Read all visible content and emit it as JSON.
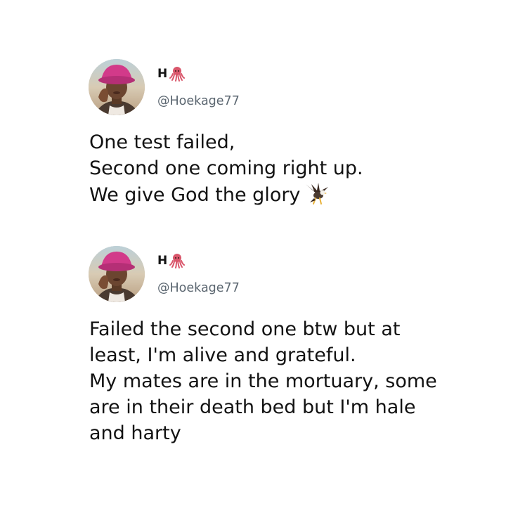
{
  "tweets": [
    {
      "display_name": "H",
      "name_emoji": "octopus-icon",
      "handle": "@Hoekage77",
      "lines": [
        "One test failed,",
        "Second one coming right up.",
        "We give God the glory"
      ],
      "trailing_emoji": "eagle-icon"
    },
    {
      "display_name": "H",
      "name_emoji": "octopus-icon",
      "handle": "@Hoekage77",
      "lines": [
        "Failed the second one btw but at",
        "least, I'm alive and grateful.",
        "My mates are in the mortuary, some",
        "are in their death bed but I'm hale",
        "and harty"
      ]
    }
  ],
  "colors": {
    "background": "#ffffff",
    "text": "#121212",
    "handle": "#5b6670",
    "hat_pink": "#d23a8a",
    "octopus": "#d9566b"
  }
}
